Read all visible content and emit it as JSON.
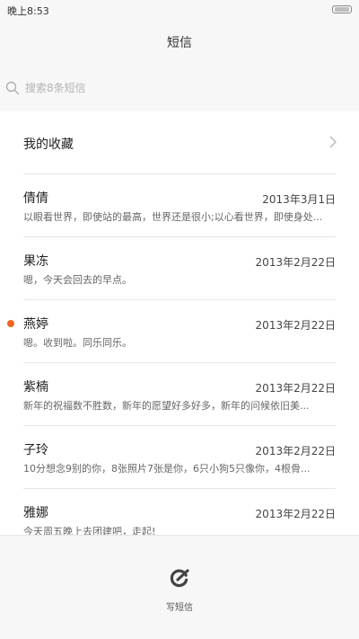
{
  "status_bar": {
    "time": "晚上8:53"
  },
  "header": {
    "title": "短信"
  },
  "search": {
    "placeholder": "搜索8条短信"
  },
  "favorites": {
    "label": "我的收藏"
  },
  "messages": [
    {
      "name": "倩倩",
      "date": "2013年3月1日",
      "preview": "以眼看世界，即使站的最高，世界还是很小;以心看世界，即使身处...",
      "unread": false
    },
    {
      "name": "果冻",
      "date": "2013年2月22日",
      "preview": "嗯，今天会回去的早点。",
      "unread": false
    },
    {
      "name": "燕婷",
      "date": "2013年2月22日",
      "preview": "嗯。收到啦。同乐同乐。",
      "unread": true
    },
    {
      "name": "紫楠",
      "date": "2013年2月22日",
      "preview": "新年的祝福数不胜数，新年的愿望好多好多，新年的问候依旧美...",
      "unread": false
    },
    {
      "name": "子玲",
      "date": "2013年2月22日",
      "preview": "10分想念9别的你，8张照片7张是你，6只小狗5只像你，4根骨...",
      "unread": false
    },
    {
      "name": "雅娜",
      "date": "2013年2月22日",
      "preview": "今天周五晚上去团建吧，走起!",
      "unread": false
    }
  ],
  "compose": {
    "label": "写短信"
  },
  "colors": {
    "unread_dot": "#f06424",
    "background": "#f7f7f7",
    "panel": "#ffffff"
  }
}
